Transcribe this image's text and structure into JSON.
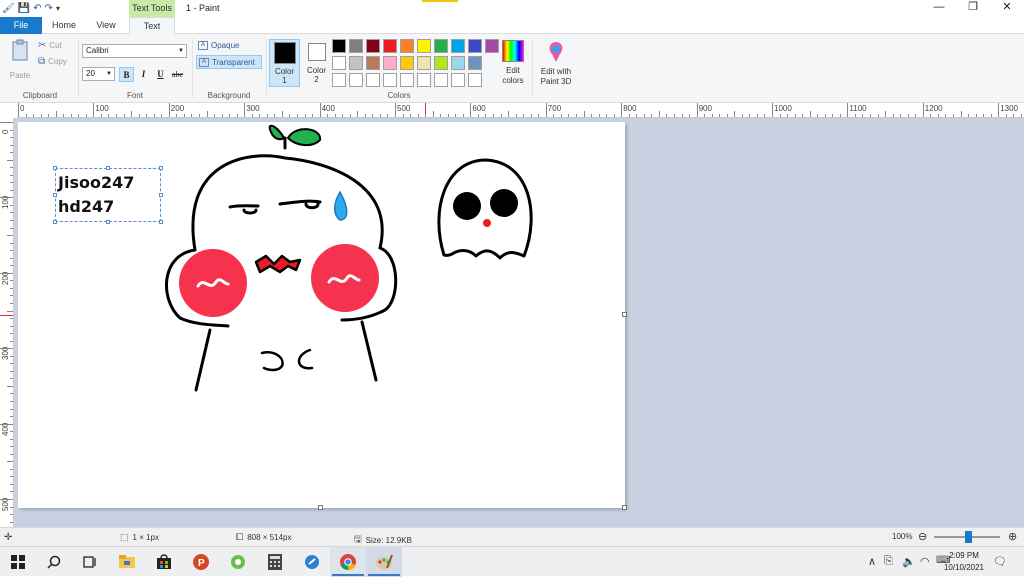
{
  "titlebar": {
    "contextual_tab": "Text Tools",
    "title": "1 - Paint",
    "minimize": "—",
    "restore": "❐",
    "close": "✕"
  },
  "tabs": {
    "file": "File",
    "home": "Home",
    "view": "View",
    "text": "Text"
  },
  "ribbon": {
    "clipboard": {
      "paste": "Paste",
      "cut": "Cut",
      "copy": "Copy",
      "label": "Clipboard"
    },
    "font": {
      "family": "Calibri",
      "size": "20",
      "bold": "B",
      "italic": "I",
      "underline": "U",
      "strike": "abc",
      "label": "Font"
    },
    "background": {
      "opaque": "Opaque",
      "transparent": "Transparent",
      "label": "Background"
    },
    "colors": {
      "color1_label": "Color",
      "color1_num": "1",
      "color2_label": "Color",
      "color2_num": "2",
      "edit_colors_1": "Edit",
      "edit_colors_2": "colors",
      "label": "Colors",
      "color1": "#000000",
      "color2": "#ffffff",
      "palette": [
        "#000000",
        "#7f7f7f",
        "#880015",
        "#ed1c24",
        "#ff7f27",
        "#fff200",
        "#22b14c",
        "#00a2e8",
        "#3f48cc",
        "#ffffff",
        "#c3c3c3",
        "#b97a57",
        "#ffaec9",
        "#ffc90e",
        "#efe4b0",
        "#b5e61d",
        "#99d9ea",
        "#7092be",
        "#ffffff",
        "#ffffff",
        "#ffffff",
        "#ffffff",
        "#ffffff",
        "#ffffff",
        "#ffffff",
        "#ffffff",
        "#ffffff"
      ],
      "extra_color": "#a349a4"
    },
    "paint3d_1": "Edit with",
    "paint3d_2": "Paint 3D"
  },
  "ruler": {
    "h": [
      "0",
      "100",
      "200",
      "300",
      "400",
      "500",
      "600",
      "700",
      "800",
      "900",
      "1000",
      "1100",
      "1200",
      "1300"
    ],
    "v": [
      "0",
      "100",
      "200",
      "300",
      "400",
      "500"
    ]
  },
  "canvas": {
    "text_line1": "Jisoo247",
    "text_line2": "hd247"
  },
  "status": {
    "selection": "1 × 1px",
    "dimensions": "808 × 514px",
    "size": "Size: 12.9KB",
    "zoom": "100%"
  },
  "taskbar": {
    "time": "2:09 PM",
    "date": "10/10/2021"
  }
}
